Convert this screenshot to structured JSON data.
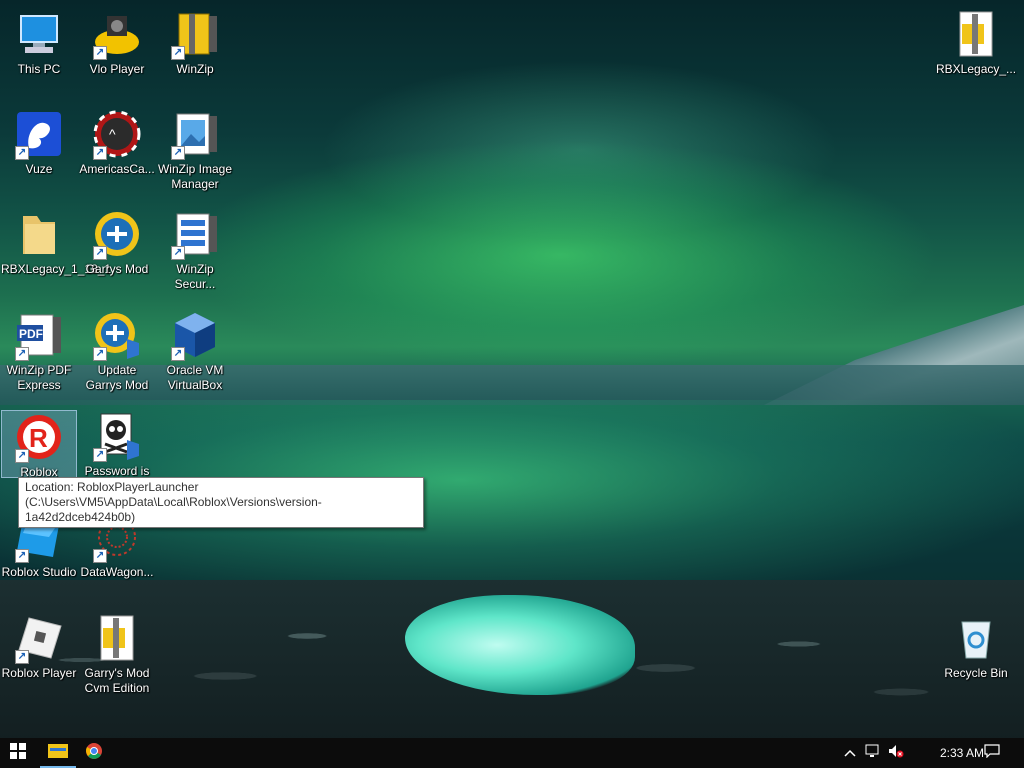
{
  "desktop": {
    "icons": [
      {
        "label": "This PC",
        "icon": "this-pc-icon"
      },
      {
        "label": "Vlo Player",
        "icon": "vlo-player-icon"
      },
      {
        "label": "WinZip",
        "icon": "winzip-icon"
      },
      {
        "label": "RBXLegacy_...",
        "icon": "zip-archive-icon"
      },
      {
        "label": "Vuze",
        "icon": "vuze-icon"
      },
      {
        "label": "AmericasCa...",
        "icon": "poker-chip-icon"
      },
      {
        "label": "WinZip Image Manager",
        "icon": "winzip-image-manager-icon"
      },
      {
        "label": "RBXLegacy_1_18_1",
        "icon": "folder-icon"
      },
      {
        "label": "Garrys Mod",
        "icon": "garrys-mod-icon"
      },
      {
        "label": "WinZip Secur...",
        "icon": "winzip-secure-icon"
      },
      {
        "label": "WinZip PDF Express",
        "icon": "winzip-pdf-icon"
      },
      {
        "label": "Update Garrys Mod",
        "icon": "update-garrys-mod-icon"
      },
      {
        "label": "Oracle VM VirtualBox",
        "icon": "virtualbox-icon"
      },
      {
        "label": "Roblox",
        "icon": "roblox-icon"
      },
      {
        "label": "Password is",
        "icon": "skull-icon"
      },
      {
        "label": "Roblox Studio",
        "icon": "roblox-studio-icon"
      },
      {
        "label": "DataWagon...",
        "icon": "datawagon-icon"
      },
      {
        "label": "Roblox Player",
        "icon": "roblox-player-icon"
      },
      {
        "label": "Garry's Mod Cvm Edition",
        "icon": "zip-archive-icon"
      },
      {
        "label": "Recycle Bin",
        "icon": "recycle-bin-icon"
      }
    ],
    "tooltip": "Location: RobloxPlayerLauncher (C:\\Users\\VM5\\AppData\\Local\\Roblox\\Versions\\version-1a42d2dceb424b0b)"
  },
  "taskbar": {
    "start": "windows-start-icon",
    "pinned": [
      "file-explorer-icon",
      "chrome-icon"
    ],
    "tray": [
      "chevron-up-icon",
      "network-icon",
      "volume-muted-icon"
    ],
    "clock": "2:33 AM",
    "notifications": "action-center-icon"
  }
}
